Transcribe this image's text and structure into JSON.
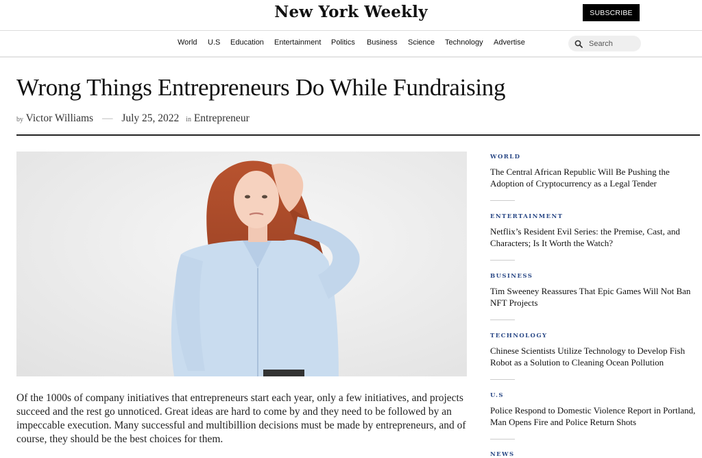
{
  "header": {
    "logo": "New York Weekly",
    "subscribe_label": "SUBSCRIBE"
  },
  "nav": {
    "items": [
      "World",
      "U.S",
      "Education",
      "Entertainment",
      "Politics",
      "Business",
      "Science",
      "Technology",
      "Advertise"
    ],
    "search_placeholder": "Search"
  },
  "article": {
    "title": "Wrong Things Entrepreneurs Do While Fundraising",
    "by_label": "by",
    "author": "Victor Williams",
    "separator": "—",
    "date": "July 25, 2022",
    "in_label": "in",
    "category": "Entrepreneur",
    "body": "Of the 1000s of company initiatives that entrepreneurs start each year, only a few initiatives, and projects succeed and the rest go unnoticed. Great ideas are hard to come by and they need to be followed by an impeccable execution. Many successful and multibillion decisions must be made by entrepreneurs, and of course, they should be the best choices for them."
  },
  "sidebar": {
    "items": [
      {
        "category": "WORLD",
        "title": "The Central African Republic Will Be Pushing the Adoption of Cryptocurrency as a Legal Tender"
      },
      {
        "category": "ENTERTAINMENT",
        "title": "Netflix’s Resident Evil Series: the Premise, Cast, and Characters; Is It Worth the Watch?"
      },
      {
        "category": "BUSINESS",
        "title": "Tim Sweeney Reassures That Epic Games Will Not Ban NFT Projects"
      },
      {
        "category": "TECHNOLOGY",
        "title": "Chinese Scientists Utilize Technology to Develop Fish Robot as a Solution to Cleaning Ocean Pollution"
      },
      {
        "category": "U.S",
        "title": "Police Respond to Domestic Violence Report in Portland, Man Opens Fire and Police Return Shots"
      },
      {
        "category": "NEWS",
        "title": ""
      }
    ]
  },
  "colors": {
    "category_blue": "#2c4a87",
    "subscribe_bg": "#000000",
    "search_bg": "#efefef"
  },
  "icons": {
    "search": "search-icon"
  }
}
